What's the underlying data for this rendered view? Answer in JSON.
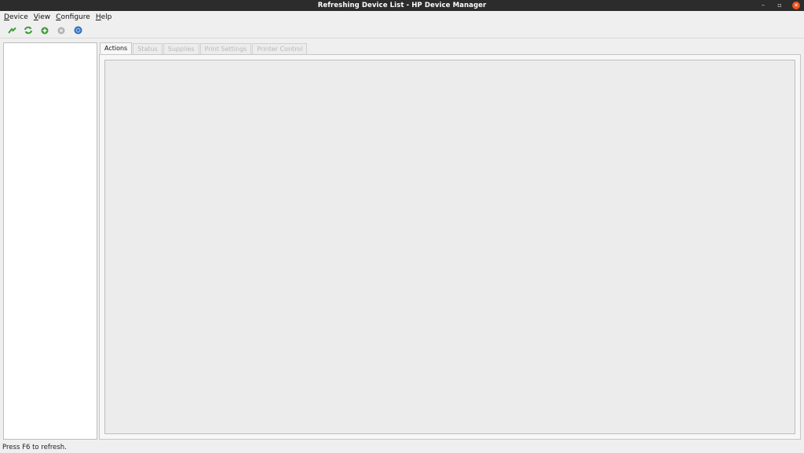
{
  "window": {
    "title": "Refreshing Device List - HP Device Manager",
    "controls": {
      "minimize": "–",
      "maximize": "▫",
      "close": "✕"
    }
  },
  "menubar": {
    "items": [
      {
        "mnemonic": "D",
        "rest": "evice"
      },
      {
        "mnemonic": "V",
        "rest": "iew"
      },
      {
        "mnemonic": "C",
        "rest": "onfigure"
      },
      {
        "mnemonic": "H",
        "rest": "elp"
      }
    ]
  },
  "toolbar": {
    "icons": [
      "setup-device-icon",
      "refresh-icon",
      "add-icon",
      "settings-icon",
      "help-icon"
    ],
    "colors": {
      "green": "#3e9b3a",
      "blue": "#2a6ab8",
      "grey": "#9a9a9a"
    }
  },
  "tabs": [
    "Actions",
    "Status",
    "Supplies",
    "Print Settings",
    "Printer Control"
  ],
  "active_tab": "Actions",
  "statusbar": {
    "text": "Press F6 to refresh."
  },
  "colors": {
    "titlebar": "#2c2c2c",
    "close": "#e95420",
    "window_bg": "#efefef"
  }
}
